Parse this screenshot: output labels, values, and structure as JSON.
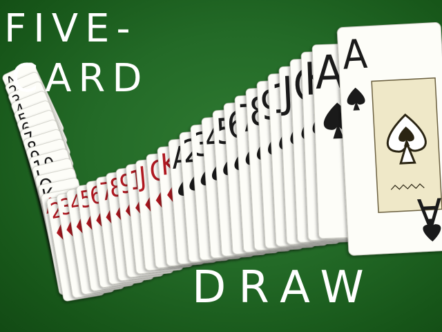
{
  "title": {
    "line1": "FIVE-",
    "line2": "CARD",
    "line3": "DRAW"
  },
  "colors": {
    "felt": "#236a27",
    "card": "#fdfdf8",
    "spade": "#1a1a1a",
    "diamond": "#b01820",
    "face_panel": "#efe8c8"
  },
  "ranks": [
    "A",
    "2",
    "3",
    "4",
    "5",
    "6",
    "7",
    "8",
    "9",
    "10",
    "J",
    "Q",
    "K"
  ],
  "suits": [
    "spade-icon",
    "diamond-icon",
    "club-icon"
  ],
  "featured_card": {
    "rank": "A",
    "suit": "spade-icon"
  }
}
